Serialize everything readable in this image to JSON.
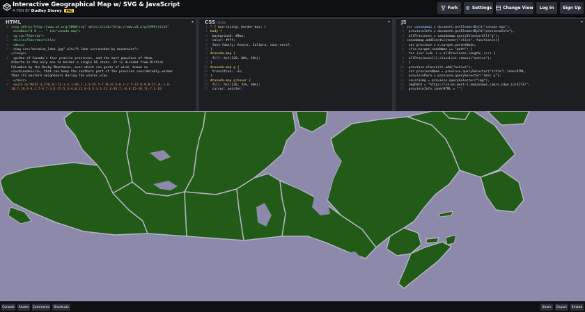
{
  "header": {
    "title": "Interactive Geographical Map w/ SVG & JavaScript",
    "by": "A PEN BY",
    "author": "Dudley Storey",
    "pro_badge": "PRO",
    "buttons": {
      "fork": "Fork",
      "settings": "Settings",
      "change_view": "Change View",
      "login": "Log In",
      "signup": "Sign Up"
    }
  },
  "editors": {
    "html": {
      "title": "HTML",
      "lines": [
        "<svg xmlns=\"http://www.w3.org/2000/svg\" xmlns:xlink=\"http://www.w3.org/1999/xlink\"",
        "  viewBox=\"0 0 ... \" id=\"canada-map\">",
        "  <g id=\"Alberta\">",
        "    <title>Alberta</title>",
        "    <desc>",
        "      <img src=\"moraine_lake.jpg\" alt=\"A lake surrounded by mountains\">",
        "</image>",
        "      <p>One of Canada's four prairie provinces, and the most populous of them,",
        "Alberta is the only one to border a single US state. It is divided from British",
        "Columbia by the Rocky Mountains, over which run gusts of wind, known as",
        "<i>chinooks</i>, that can keep the southern part of the province considerably warmer",
        "than its eastern neighbours during the winter.</p>",
        "    </desc>",
        "    <path d=\"M435.3,270.2L-13.1-3.1-44.7,3.1-55.5-7.9L-6.5-8.1-2.5-17.8-9.8-17.3L-1.8-",
        "10.7,19.4-9.2.7-4.7-3.4-15-5.3-4.8,15.8-3.3-3.1-23.3-36.7,-8.8,15-10.7L-7.3-10"
      ]
    },
    "css": {
      "title": "CSS",
      "subtitle": "(SCSS)",
      "lines": [
        "* { box-sizing: border-box; }",
        "body {",
        "  background: #8ba;",
        "  color: #fff;",
        "  font-family: Avenir, Calibra, sans-serif;",
        "}",
        "#canada-map {",
        "  fill: hsl(120, 60%, 18%);",
        "}",
        "#canada-map g {",
        "  transition: .3s;",
        "}",
        "#canada-map g:hover {",
        "  fill: hsl(120, 33%, 40%);",
        "  cursor: pointer;"
      ]
    },
    "js": {
      "title": "JS",
      "lines": [
        "var canadamap = document.getElementById(\"canada-map\"),",
        "  provinceInfo = document.getElementById(\"provinceInfo\"),",
        "  allProvinces = canadamap.querySelectorAll(\"g\");",
        "canadamap.addEventListener(\"click\", function(e){",
        "  var province = e.target.parentNode;",
        "  if(e.target.nodeName == \"path\") {",
        "    for (var i=0; i < allProvinces.length; i++) {",
        "      allProvinces[i].classList.remove(\"active\");",
        "    }",
        "    province.classList.add(\"active\");",
        "    var provinceName = province.querySelector(\"title\").innerHTML,",
        "    provincePara = province.querySelector(\"desc p\");",
        "    sourceImg = province.querySelector(\"img\"),",
        "    imgPath = \"https://s3-us-west-2.amazonaws.com/s.cdpn.io/4273/\";",
        "    provinceInfo.innerHTML = \"\";"
      ]
    }
  },
  "colors": {
    "land": "#225b17",
    "water": "#8c89aa",
    "border": "#b4b4c4"
  },
  "footer": {
    "console": "Console",
    "assets": "Assets",
    "comments": "Comments",
    "shortcuts": "Shortcuts",
    "share": "Share",
    "export": "Export",
    "embed": "Embed"
  }
}
